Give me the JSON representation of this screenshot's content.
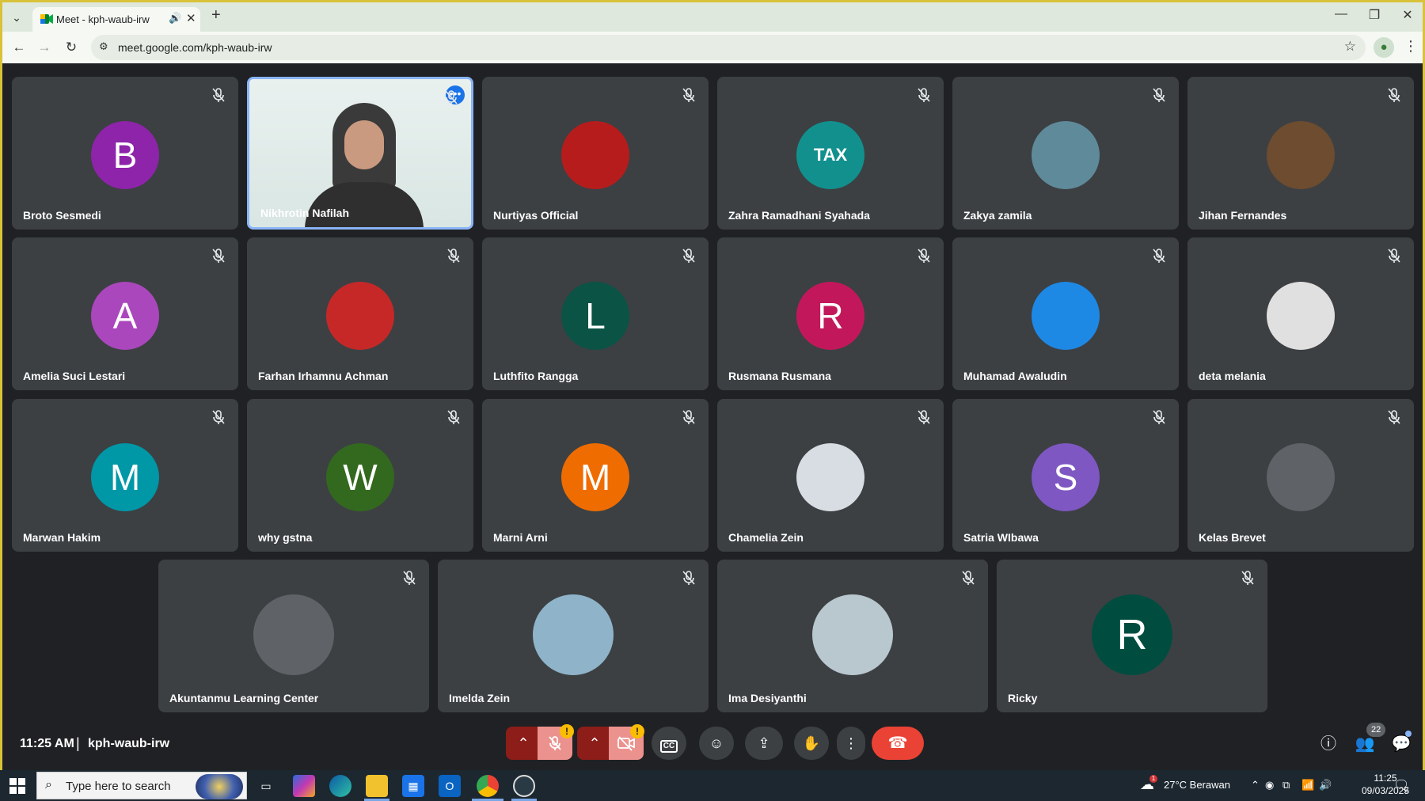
{
  "browser": {
    "tab_title": "Meet - kph-waub-irw",
    "url": "meet.google.com/kph-waub-irw"
  },
  "participants": [
    {
      "name": "Broto Sesmedi",
      "initial": "B",
      "color": "#8e24aa"
    },
    {
      "name": "Nikhrotin Nafilah",
      "initial": "",
      "color": "",
      "video": true
    },
    {
      "name": "Nurtiyas Official",
      "initial": "",
      "color": "#b71c1c"
    },
    {
      "name": "Zahra Ramadhani Syahada",
      "initial": "TAX",
      "color": "#12908e"
    },
    {
      "name": "Zakya zamila",
      "initial": "",
      "color": "#5f8a9a"
    },
    {
      "name": "Jihan Fernandes",
      "initial": "",
      "color": "#6d4c2f"
    },
    {
      "name": "Amelia Suci Lestari",
      "initial": "A",
      "color": "#ab47bc"
    },
    {
      "name": "Farhan Irhamnu Achman",
      "initial": "",
      "color": "#c62828"
    },
    {
      "name": "Luthfito Rangga",
      "initial": "L",
      "color": "#0b5345"
    },
    {
      "name": "Rusmana Rusmana",
      "initial": "R",
      "color": "#c2185b"
    },
    {
      "name": "Muhamad Awaludin",
      "initial": "",
      "color": "#1e88e5"
    },
    {
      "name": "deta melania",
      "initial": "",
      "color": "#e0e0e0"
    },
    {
      "name": "Marwan Hakim",
      "initial": "M",
      "color": "#0097a7"
    },
    {
      "name": "why gstna",
      "initial": "W",
      "color": "#33691e"
    },
    {
      "name": "Marni Arni",
      "initial": "M",
      "color": "#ef6c00"
    },
    {
      "name": "Chamelia Zein",
      "initial": "",
      "color": "#d7dde3"
    },
    {
      "name": "Satria WIbawa",
      "initial": "S",
      "color": "#7e57c2"
    },
    {
      "name": "Kelas Brevet",
      "initial": "",
      "color": "#5f6368"
    },
    {
      "name": "Akuntanmu Learning Center",
      "initial": "",
      "color": "#5f6368"
    },
    {
      "name": "Imelda Zein",
      "initial": "",
      "color": "#8fb4c9"
    },
    {
      "name": "Ima Desiyanthi",
      "initial": "",
      "color": "#b9c7cf"
    },
    {
      "name": "Ricky",
      "initial": "R",
      "color": "#004d40"
    }
  ],
  "meeting": {
    "time": "11:25 AM",
    "separator": "|",
    "code": "kph-waub-irw",
    "participant_count": "22",
    "warning_mark": "!"
  },
  "taskbar": {
    "search_placeholder": "Type here to search",
    "weather": "27°C  Berawan",
    "weather_alert": "1",
    "time": "11:25",
    "date": "09/03/2025",
    "notification_count": "2"
  }
}
